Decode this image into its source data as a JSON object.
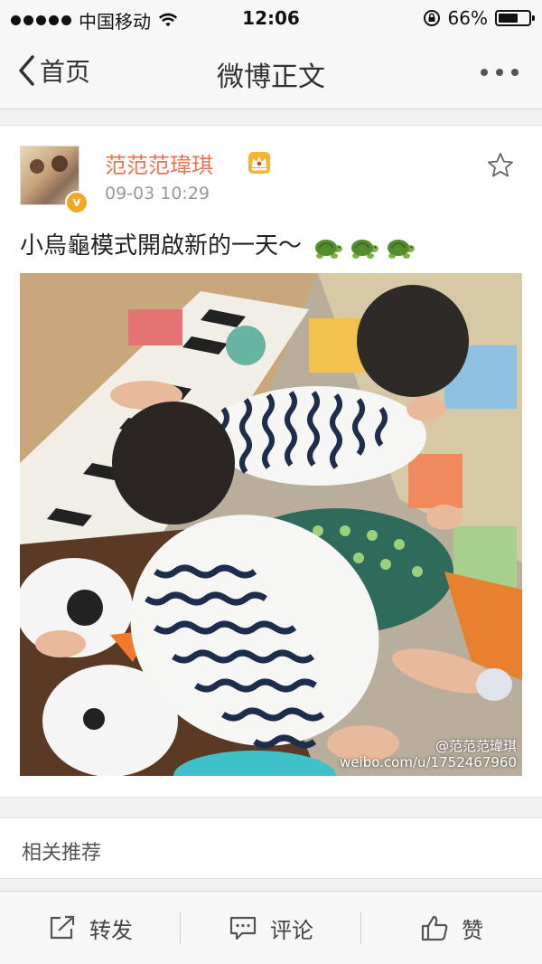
{
  "status_bar": {
    "carrier": "中国移动",
    "time": "12:06",
    "battery_text": "66%",
    "battery_level": 0.66
  },
  "nav": {
    "back_label": "首页",
    "title": "微博正文"
  },
  "post": {
    "username": "范范范瑋琪",
    "time": "09-03 10:29",
    "text": "小烏龜模式開啟新的一天～",
    "verified_mark": "v",
    "watermark_handle": "@范范范瑋琪",
    "watermark_url": "weibo.com/u/1752467960",
    "name_color": "#eb7350"
  },
  "related": {
    "label": "相关推荐"
  },
  "toolbar": {
    "repost_label": "转发",
    "comment_label": "评论",
    "like_label": "赞"
  },
  "icons": [
    "chevron-left-icon",
    "more-dots-icon",
    "star-icon",
    "crown-icon",
    "turtle-icon",
    "repost-icon",
    "comment-icon",
    "like-icon",
    "wifi-icon",
    "lock-rotation-icon",
    "battery-icon"
  ]
}
